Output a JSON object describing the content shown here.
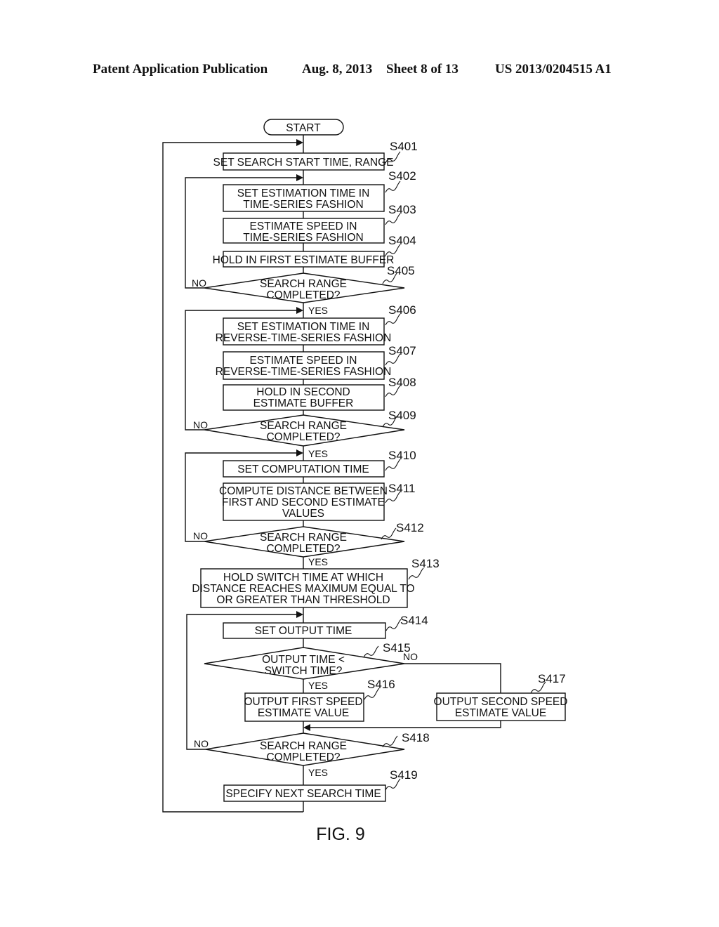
{
  "header": {
    "publication": "Patent Application Publication",
    "date": "Aug. 8, 2013",
    "sheet": "Sheet 8 of 13",
    "number": "US 2013/0204515 A1"
  },
  "figure_label": "FIG. 9",
  "terminal": {
    "start": "START"
  },
  "branch_labels": {
    "yes": "YES",
    "no": "NO"
  },
  "steps": {
    "s401": {
      "id": "S401",
      "lines": [
        "SET SEARCH START TIME, RANGE"
      ]
    },
    "s402": {
      "id": "S402",
      "lines": [
        "SET ESTIMATION TIME IN",
        "TIME-SERIES FASHION"
      ]
    },
    "s403": {
      "id": "S403",
      "lines": [
        "ESTIMATE SPEED IN",
        "TIME-SERIES FASHION"
      ]
    },
    "s404": {
      "id": "S404",
      "lines": [
        "HOLD IN FIRST ESTIMATE BUFFER"
      ]
    },
    "s405": {
      "id": "S405",
      "lines": [
        "SEARCH RANGE",
        "COMPLETED?"
      ]
    },
    "s406": {
      "id": "S406",
      "lines": [
        "SET ESTIMATION TIME IN",
        "REVERSE-TIME-SERIES FASHION"
      ]
    },
    "s407": {
      "id": "S407",
      "lines": [
        "ESTIMATE SPEED IN",
        "REVERSE-TIME-SERIES FASHION"
      ]
    },
    "s408": {
      "id": "S408",
      "lines": [
        "HOLD IN SECOND",
        "ESTIMATE BUFFER"
      ]
    },
    "s409": {
      "id": "S409",
      "lines": [
        "SEARCH RANGE",
        "COMPLETED?"
      ]
    },
    "s410": {
      "id": "S410",
      "lines": [
        "SET COMPUTATION TIME"
      ]
    },
    "s411": {
      "id": "S411",
      "lines": [
        "COMPUTE DISTANCE BETWEEN",
        "FIRST AND SECOND ESTIMATE",
        "VALUES"
      ]
    },
    "s412": {
      "id": "S412",
      "lines": [
        "SEARCH RANGE",
        "COMPLETED?"
      ]
    },
    "s413": {
      "id": "S413",
      "lines": [
        "HOLD SWITCH TIME AT WHICH",
        "DISTANCE REACHES MAXIMUM EQUAL TO",
        "OR GREATER THAN THRESHOLD"
      ]
    },
    "s414": {
      "id": "S414",
      "lines": [
        "SET OUTPUT TIME"
      ]
    },
    "s415": {
      "id": "S415",
      "lines": [
        "OUTPUT TIME <",
        "SWITCH TIME?"
      ]
    },
    "s416": {
      "id": "S416",
      "lines": [
        "OUTPUT FIRST SPEED",
        "ESTIMATE VALUE"
      ]
    },
    "s417": {
      "id": "S417",
      "lines": [
        "OUTPUT SECOND SPEED",
        "ESTIMATE VALUE"
      ]
    },
    "s418": {
      "id": "S418",
      "lines": [
        "SEARCH RANGE",
        "COMPLETED?"
      ]
    },
    "s419": {
      "id": "S419",
      "lines": [
        "SPECIFY NEXT SEARCH TIME"
      ]
    }
  }
}
